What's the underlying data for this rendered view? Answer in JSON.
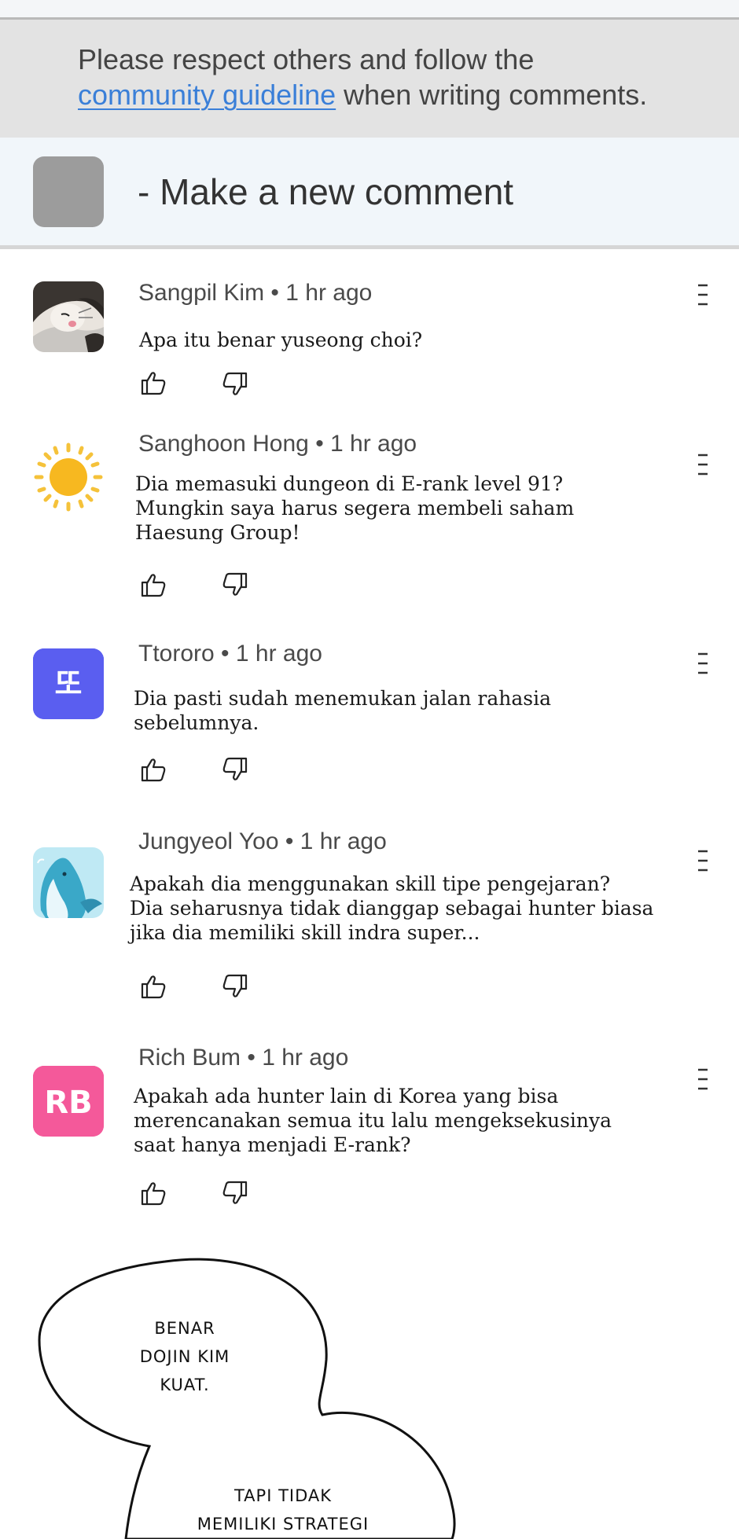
{
  "notice": {
    "line1": "Please respect others and follow the",
    "link": "community guideline",
    "line2_rest": " when writing comments."
  },
  "composer": {
    "label": "- Make a new comment"
  },
  "comments": [
    {
      "meta": "Sangpil Kim • 1 hr ago",
      "avatar": "cat-avatar",
      "lines": [
        "Apa itu benar yuseong choi?"
      ]
    },
    {
      "meta": "Sanghoon Hong • 1 hr ago",
      "avatar": "sun-avatar",
      "lines": [
        "Dia memasuki dungeon di E-rank level 91?",
        "Mungkin saya harus segera membeli saham",
        "Haesung Group!"
      ]
    },
    {
      "meta": "Ttororo • 1 hr ago",
      "avatar": "또",
      "avatar_color": "#5a5ef0",
      "lines": [
        "Dia pasti sudah menemukan jalan rahasia",
        "sebelumnya."
      ]
    },
    {
      "meta": "Jungyeol Yoo • 1 hr ago",
      "avatar": "whale-avatar",
      "lines": [
        "Apakah dia menggunakan skill tipe pengejaran?",
        "Dia seharusnya tidak dianggap sebagai hunter biasa",
        "jika dia memiliki skill indra super..."
      ]
    },
    {
      "meta": "Rich Bum • 1 hr ago",
      "avatar": "RB",
      "avatar_color": "#f4599a",
      "lines": [
        "Apakah ada hunter lain di Korea yang bisa",
        "merencanakan semua itu lalu mengeksekusinya",
        "saat hanya menjadi E-rank?"
      ]
    }
  ],
  "icons": {
    "like": "thumbs-up-icon",
    "dislike": "thumbs-down-icon",
    "more": "more-menu-icon"
  },
  "comic": {
    "bubble1": [
      "BENAR",
      "DOJIN KIM",
      "KUAT."
    ],
    "bubble2": [
      "TAPI TIDAK",
      "MEMILIKI STRATEGI"
    ]
  }
}
